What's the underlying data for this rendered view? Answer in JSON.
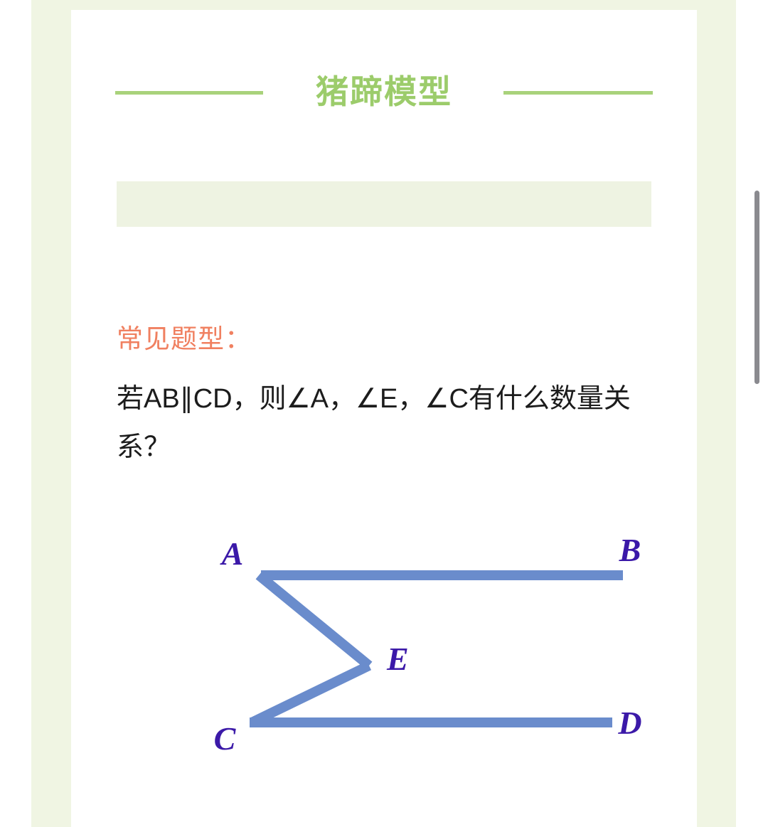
{
  "page": {
    "background_color": "#f0f5e3",
    "card_color": "#ffffff"
  },
  "header": {
    "title": "猪蹄模型",
    "title_color": "#9ccc6b",
    "rule_color": "#a9d27b"
  },
  "banner": {
    "text": "",
    "background_color": "#eef3e2"
  },
  "content": {
    "section_label": "常见题型：",
    "section_label_color": "#f08060",
    "question": "若AB∥CD，则∠A，∠E，∠C有什么数量关系？"
  },
  "figure": {
    "name": "pig-hoof-diagram",
    "line_color": "#6a8ccc",
    "label_color": "#3b19a8",
    "labels": {
      "a": "A",
      "b": "B",
      "c": "C",
      "d": "D",
      "e": "E"
    },
    "segments": [
      {
        "name": "AB",
        "from": "A",
        "to": "B"
      },
      {
        "name": "AE",
        "from": "A",
        "to": "E"
      },
      {
        "name": "EC",
        "from": "E",
        "to": "C"
      },
      {
        "name": "CD",
        "from": "C",
        "to": "D"
      }
    ]
  },
  "scrollbar": {
    "color": "#8a8a8f"
  }
}
